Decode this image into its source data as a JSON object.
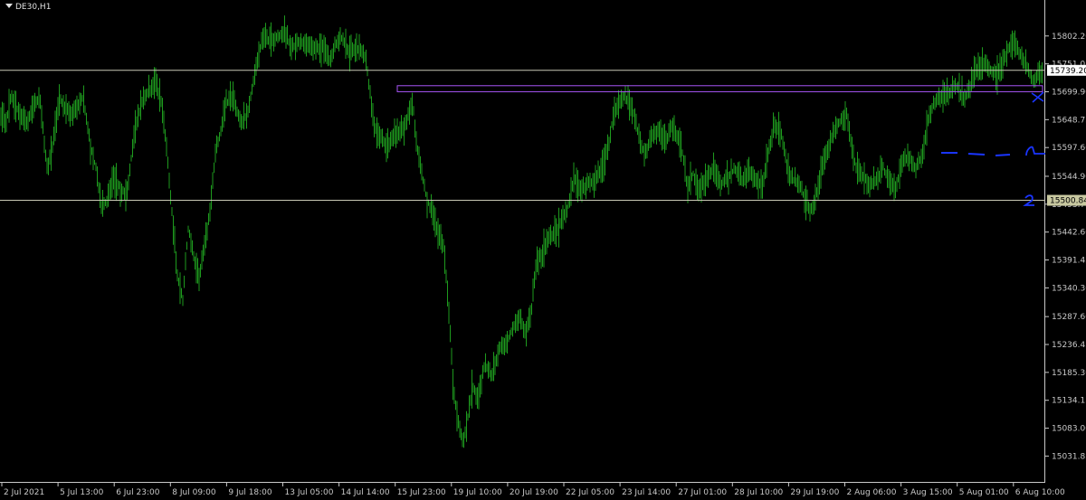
{
  "window": {
    "symbol": "DE30,H1"
  },
  "colors": {
    "background": "#000000",
    "candle": "#1e9a1e",
    "hline": "#c8c8b4",
    "rect": "#a855f7",
    "hand": "#1a35ff",
    "axis_text": "#c8c8c8"
  },
  "chart_data": {
    "type": "bar",
    "symbol": "DE30",
    "timeframe": "H1",
    "ylim": [
      15006,
      15835
    ],
    "y_ticks": [
      "15802.20",
      "15751.05",
      "15699.90",
      "15648.75",
      "15597.60",
      "15544.90",
      "15493.75",
      "15442.60",
      "15391.45",
      "15340.30",
      "15287.60",
      "15236.45",
      "15185.30",
      "15134.15",
      "15083.00",
      "15031.85"
    ],
    "x_ticks": [
      "2 Jul 2021",
      "5 Jul 13:00",
      "6 Jul 23:00",
      "8 Jul 09:00",
      "9 Jul 18:00",
      "13 Jul 05:00",
      "14 Jul 14:00",
      "15 Jul 23:00",
      "19 Jul 10:00",
      "20 Jul 19:00",
      "22 Jul 05:00",
      "23 Jul 14:00",
      "27 Jul 01:00",
      "28 Jul 10:00",
      "29 Jul 19:00",
      "2 Aug 06:00",
      "3 Aug 15:00",
      "5 Aug 01:00",
      "6 Aug 10:00"
    ],
    "price_path": [
      [
        0,
        15660
      ],
      [
        6,
        15640
      ],
      [
        12,
        15690
      ],
      [
        18,
        15670
      ],
      [
        24,
        15655
      ],
      [
        30,
        15640
      ],
      [
        38,
        15680
      ],
      [
        44,
        15690
      ],
      [
        52,
        15560
      ],
      [
        58,
        15600
      ],
      [
        66,
        15690
      ],
      [
        74,
        15665
      ],
      [
        82,
        15660
      ],
      [
        92,
        15690
      ],
      [
        100,
        15600
      ],
      [
        106,
        15560
      ],
      [
        112,
        15490
      ],
      [
        118,
        15500
      ],
      [
        126,
        15540
      ],
      [
        134,
        15520
      ],
      [
        140,
        15510
      ],
      [
        148,
        15620
      ],
      [
        156,
        15680
      ],
      [
        164,
        15700
      ],
      [
        172,
        15720
      ],
      [
        178,
        15680
      ],
      [
        184,
        15600
      ],
      [
        190,
        15480
      ],
      [
        196,
        15360
      ],
      [
        202,
        15320
      ],
      [
        208,
        15450
      ],
      [
        214,
        15400
      ],
      [
        220,
        15360
      ],
      [
        226,
        15420
      ],
      [
        232,
        15480
      ],
      [
        238,
        15590
      ],
      [
        244,
        15630
      ],
      [
        250,
        15680
      ],
      [
        258,
        15690
      ],
      [
        266,
        15640
      ],
      [
        274,
        15660
      ],
      [
        280,
        15720
      ],
      [
        286,
        15770
      ],
      [
        290,
        15800
      ],
      [
        298,
        15795
      ],
      [
        306,
        15800
      ],
      [
        314,
        15810
      ],
      [
        322,
        15780
      ],
      [
        330,
        15790
      ],
      [
        340,
        15790
      ],
      [
        348,
        15780
      ],
      [
        356,
        15780
      ],
      [
        364,
        15760
      ],
      [
        372,
        15790
      ],
      [
        378,
        15800
      ],
      [
        386,
        15770
      ],
      [
        394,
        15780
      ],
      [
        402,
        15770
      ],
      [
        406,
        15740
      ],
      [
        410,
        15680
      ],
      [
        414,
        15630
      ],
      [
        420,
        15620
      ],
      [
        428,
        15600
      ],
      [
        436,
        15620
      ],
      [
        444,
        15630
      ],
      [
        450,
        15650
      ],
      [
        456,
        15680
      ],
      [
        460,
        15610
      ],
      [
        466,
        15550
      ],
      [
        472,
        15500
      ],
      [
        478,
        15480
      ],
      [
        484,
        15440
      ],
      [
        490,
        15420
      ],
      [
        496,
        15300
      ],
      [
        500,
        15180
      ],
      [
        504,
        15120
      ],
      [
        508,
        15080
      ],
      [
        512,
        15060
      ],
      [
        516,
        15090
      ],
      [
        522,
        15160
      ],
      [
        528,
        15140
      ],
      [
        536,
        15200
      ],
      [
        544,
        15180
      ],
      [
        552,
        15230
      ],
      [
        560,
        15240
      ],
      [
        568,
        15270
      ],
      [
        574,
        15290
      ],
      [
        580,
        15260
      ],
      [
        586,
        15280
      ],
      [
        592,
        15380
      ],
      [
        598,
        15400
      ],
      [
        606,
        15430
      ],
      [
        614,
        15440
      ],
      [
        620,
        15460
      ],
      [
        628,
        15490
      ],
      [
        634,
        15540
      ],
      [
        642,
        15520
      ],
      [
        650,
        15530
      ],
      [
        658,
        15540
      ],
      [
        666,
        15560
      ],
      [
        672,
        15600
      ],
      [
        678,
        15660
      ],
      [
        684,
        15680
      ],
      [
        690,
        15690
      ],
      [
        696,
        15680
      ],
      [
        702,
        15650
      ],
      [
        708,
        15600
      ],
      [
        714,
        15590
      ],
      [
        720,
        15620
      ],
      [
        728,
        15630
      ],
      [
        736,
        15610
      ],
      [
        742,
        15640
      ],
      [
        748,
        15620
      ],
      [
        754,
        15590
      ],
      [
        760,
        15520
      ],
      [
        766,
        15550
      ],
      [
        772,
        15520
      ],
      [
        780,
        15540
      ],
      [
        788,
        15560
      ],
      [
        796,
        15530
      ],
      [
        804,
        15540
      ],
      [
        812,
        15560
      ],
      [
        820,
        15540
      ],
      [
        828,
        15550
      ],
      [
        836,
        15540
      ],
      [
        842,
        15520
      ],
      [
        850,
        15600
      ],
      [
        856,
        15640
      ],
      [
        864,
        15620
      ],
      [
        870,
        15560
      ],
      [
        876,
        15540
      ],
      [
        884,
        15530
      ],
      [
        890,
        15500
      ],
      [
        896,
        15480
      ],
      [
        902,
        15510
      ],
      [
        908,
        15560
      ],
      [
        916,
        15600
      ],
      [
        922,
        15630
      ],
      [
        930,
        15650
      ],
      [
        936,
        15660
      ],
      [
        940,
        15610
      ],
      [
        946,
        15560
      ],
      [
        952,
        15550
      ],
      [
        960,
        15530
      ],
      [
        968,
        15540
      ],
      [
        976,
        15560
      ],
      [
        984,
        15530
      ],
      [
        990,
        15520
      ],
      [
        996,
        15570
      ],
      [
        1004,
        15580
      ],
      [
        1012,
        15560
      ],
      [
        1020,
        15590
      ],
      [
        1026,
        15650
      ],
      [
        1032,
        15680
      ],
      [
        1040,
        15690
      ],
      [
        1048,
        15700
      ],
      [
        1056,
        15710
      ],
      [
        1064,
        15690
      ],
      [
        1070,
        15700
      ],
      [
        1078,
        15740
      ],
      [
        1086,
        15750
      ],
      [
        1094,
        15740
      ],
      [
        1102,
        15730
      ],
      [
        1110,
        15760
      ],
      [
        1118,
        15790
      ],
      [
        1124,
        15780
      ],
      [
        1130,
        15760
      ],
      [
        1136,
        15740
      ],
      [
        1142,
        15720
      ],
      [
        1146,
        15730
      ],
      [
        1152,
        15735
      ]
    ],
    "annotations": {
      "current_price": "15739.20",
      "hline_price": "15500.84",
      "upper_hline_price": 15739.2,
      "zone_top": 15711,
      "zone_bottom": 15700
    }
  }
}
